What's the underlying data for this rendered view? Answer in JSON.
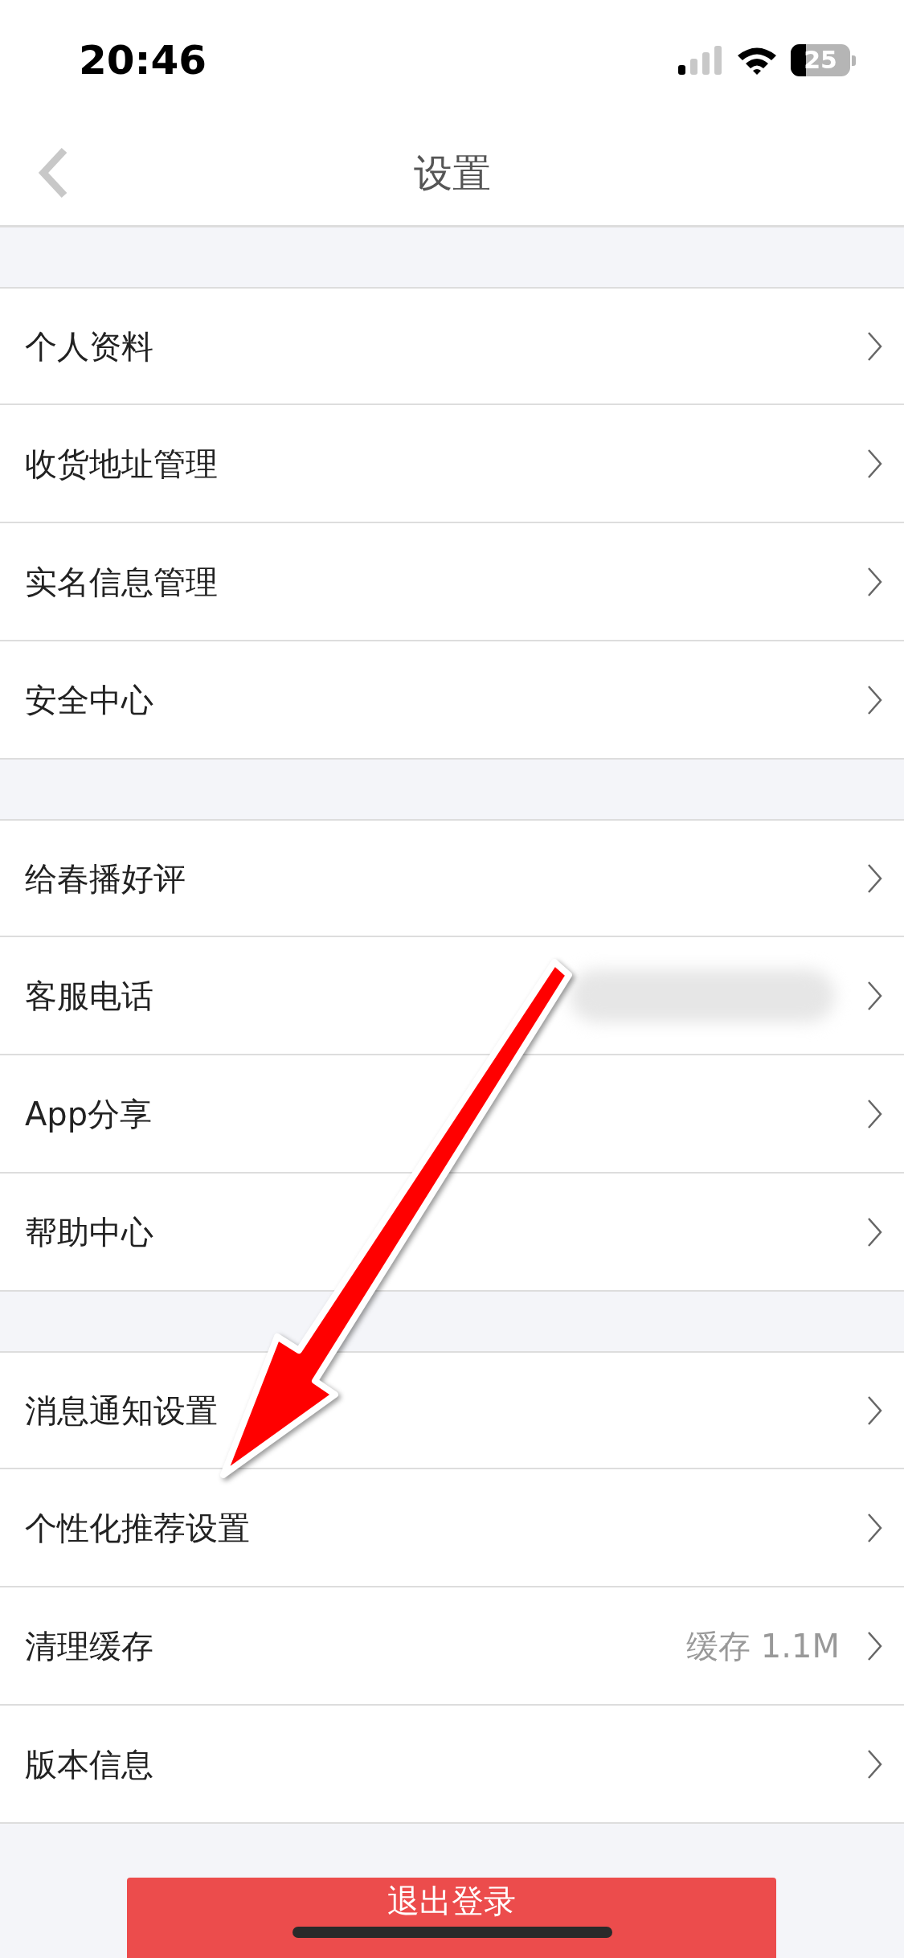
{
  "status_bar": {
    "time": "20:46",
    "battery": "25"
  },
  "nav_bar": {
    "title": "设置"
  },
  "sections": [
    {
      "items": [
        {
          "label": "个人资料"
        },
        {
          "label": "收货地址管理"
        },
        {
          "label": "实名信息管理"
        },
        {
          "label": "安全中心"
        }
      ]
    },
    {
      "items": [
        {
          "label": "给春播好评"
        },
        {
          "label": "客服电话",
          "kind": "blurred"
        },
        {
          "label": "App分享"
        },
        {
          "label": "帮助中心"
        }
      ]
    },
    {
      "items": [
        {
          "label": "消息通知设置"
        },
        {
          "label": "个性化推荐设置"
        },
        {
          "label": "清理缓存",
          "value": "缓存 1.1M"
        },
        {
          "label": "版本信息"
        }
      ]
    }
  ],
  "logout_button": {
    "label": "退出登录"
  }
}
